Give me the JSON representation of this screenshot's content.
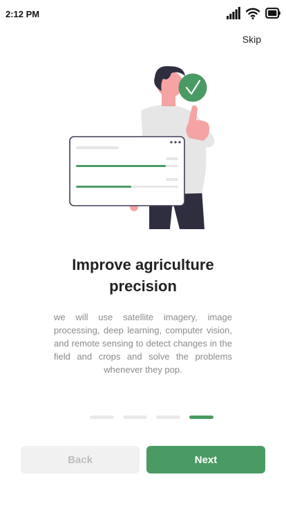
{
  "status_bar": {
    "time": "2:12 PM",
    "icons": [
      "signal-icon",
      "wifi-icon",
      "battery-icon"
    ]
  },
  "top": {
    "skip_label": "Skip"
  },
  "onboarding": {
    "title_line1": "Improve agriculture",
    "title_line2": "precision",
    "description": "we will use satellite imagery, image processing, deep learning, computer vision, and remote sensing to detect changes in the field and crops and solve the problems whenever they pop.",
    "pages_total": 4,
    "active_page": 4
  },
  "buttons": {
    "back_label": "Back",
    "next_label": "Next"
  },
  "colors": {
    "accent": "#4a9b63",
    "disabled_bg": "#f1f1f1",
    "disabled_text": "#bdbdbd",
    "body_text": "#8a8a8a"
  }
}
